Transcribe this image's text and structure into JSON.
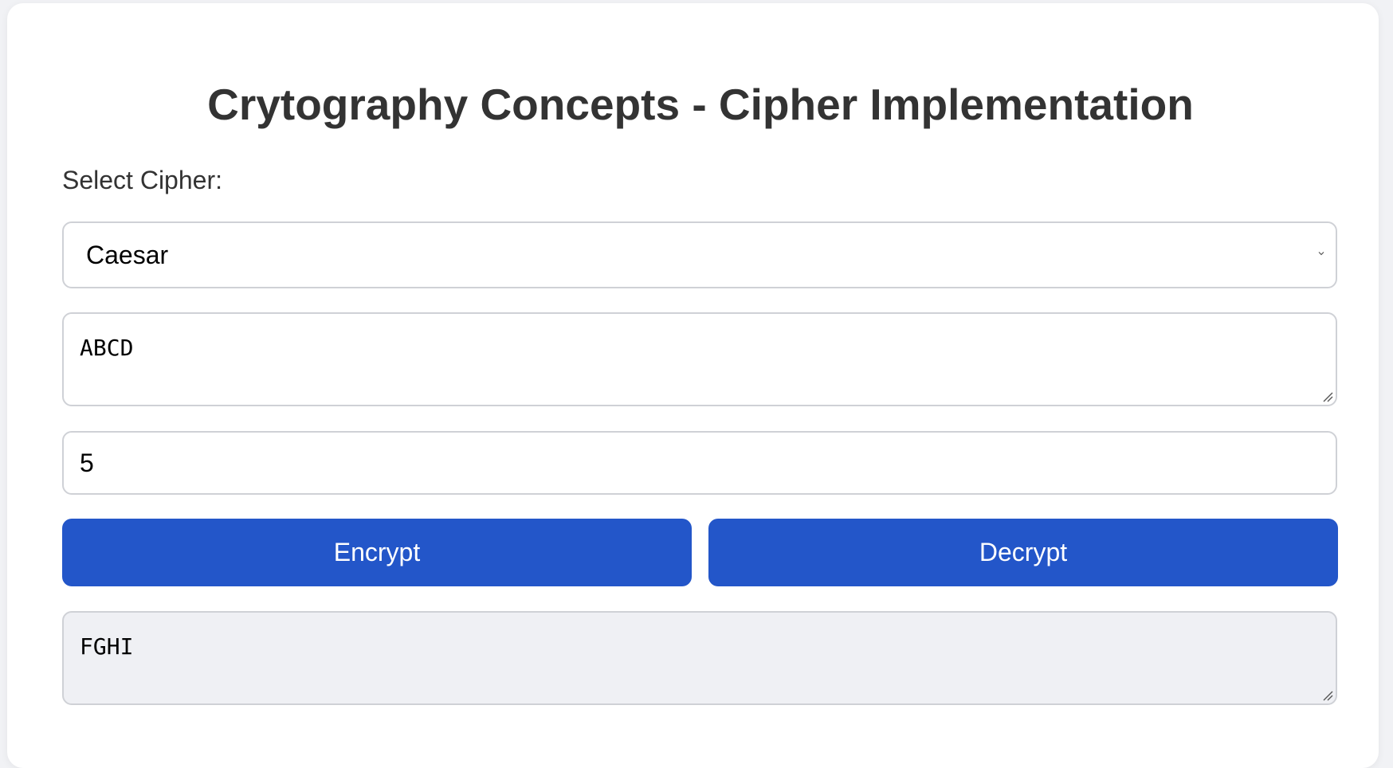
{
  "page": {
    "title": "Crytography Concepts - Cipher Implementation"
  },
  "cipher_select": {
    "label": "Select Cipher:",
    "selected": "Caesar",
    "chevron_icon": "chevron-down-icon"
  },
  "input": {
    "value": "ABCD"
  },
  "shift": {
    "value": "5"
  },
  "buttons": {
    "encrypt_label": "Encrypt",
    "decrypt_label": "Decrypt"
  },
  "output": {
    "value": "FGHI"
  },
  "colors": {
    "accent": "#2356c9",
    "output_background": "#eff0f4",
    "page_background": "#f1f2f5",
    "border": "#cfd1d6"
  }
}
